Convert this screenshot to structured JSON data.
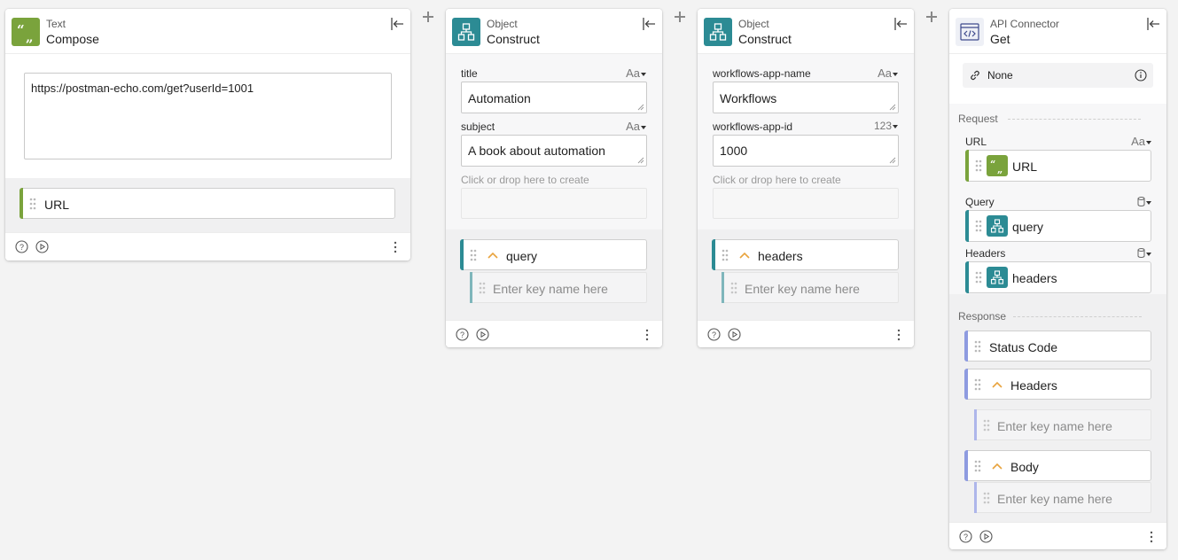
{
  "colors": {
    "text_green": "#7aa33c",
    "object_teal": "#2c8b94",
    "api_blue": "#8e9be0",
    "chevron_orange": "#e8a33d"
  },
  "cards": {
    "text_compose": {
      "type": "Text",
      "name": "Compose",
      "icon": "quote-icon",
      "value": "https://postman-echo.com/get?userId=1001",
      "output": "URL"
    },
    "object_1": {
      "type": "Object",
      "name": "Construct",
      "icon": "object-icon",
      "fields": [
        {
          "label": "title",
          "type": "Aa",
          "value": "Automation"
        },
        {
          "label": "subject",
          "type": "Aa",
          "value": "A book about automation"
        }
      ],
      "create_hint": "Click or drop here to create",
      "output": "query",
      "child_placeholder": "Enter key name here"
    },
    "object_2": {
      "type": "Object",
      "name": "Construct",
      "icon": "object-icon",
      "fields": [
        {
          "label": "workflows-app-name",
          "type": "Aa",
          "value": "Workflows"
        },
        {
          "label": "workflows-app-id",
          "type": "123",
          "value": "1000"
        }
      ],
      "create_hint": "Click or drop here to create",
      "output": "headers",
      "child_placeholder": "Enter key name here"
    },
    "api": {
      "type": "API Connector",
      "name": "Get",
      "icon": "code-icon",
      "auth": "None",
      "request_label": "Request",
      "url_label": "URL",
      "url_type": "Aa",
      "url_value": "URL",
      "query_label": "Query",
      "query_value": "query",
      "headers_label": "Headers",
      "headers_value": "headers",
      "response_label": "Response",
      "status_code": "Status Code",
      "resp_headers": "Headers",
      "resp_body": "Body",
      "child_placeholder": "Enter key name here"
    }
  }
}
